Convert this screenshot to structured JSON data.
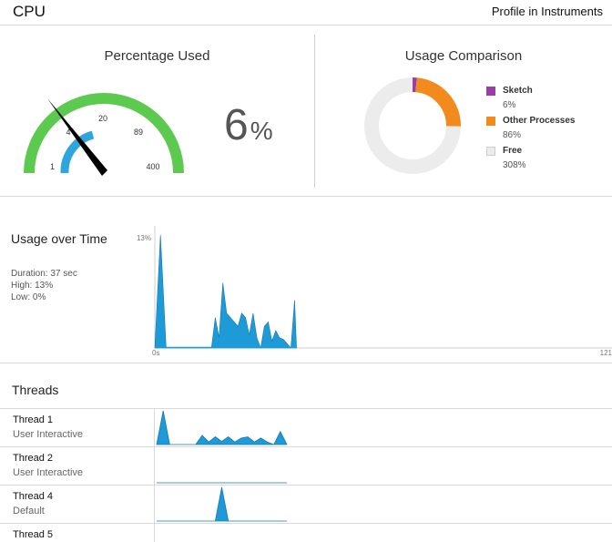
{
  "header": {
    "title": "CPU",
    "action_label": "Profile in Instruments"
  },
  "percentage_used": {
    "title": "Percentage Used",
    "value": "6",
    "unit": "%",
    "gauge": {
      "outer_ticks": [
        "1",
        "20",
        "89",
        "400"
      ],
      "inner_tick": "4",
      "outer_color": "#5cc94f",
      "inner_color": "#2ea6dd",
      "needle_color": "#000000",
      "needle_value_fraction": 0.06
    }
  },
  "usage_comparison": {
    "title": "Usage Comparison",
    "slices": [
      {
        "name": "Sketch",
        "value": "6%",
        "percent": 6,
        "color": "#9b3da5"
      },
      {
        "name": "Other Processes",
        "value": "86%",
        "percent": 86,
        "color": "#f28a1e"
      },
      {
        "name": "Free",
        "value": "308%",
        "percent": 308,
        "color": "#ececec"
      }
    ]
  },
  "usage_over_time": {
    "title": "Usage over Time",
    "duration": "Duration: 37 sec",
    "high": "High: 13%",
    "low": "Low: 0%",
    "y_max_label": "13%",
    "x_start_label": "0s",
    "x_end_label": "121",
    "fill_color": "#1e9bd7"
  },
  "chart_data": {
    "type": "area",
    "title": "",
    "xlabel": "",
    "ylabel": "",
    "y_unit": "%",
    "xlim": [
      0,
      121
    ],
    "ylim": [
      0,
      13
    ],
    "x": [
      0,
      1.5,
      3,
      4,
      6,
      13,
      15,
      16,
      17,
      18,
      19,
      20,
      21,
      22,
      23,
      24,
      25,
      26,
      27,
      28,
      29,
      30,
      31,
      32,
      33,
      34,
      35,
      36,
      37,
      37.5
    ],
    "values": [
      0,
      13,
      0,
      0,
      0,
      0,
      0,
      3.5,
      1.2,
      7.5,
      4,
      3.5,
      3,
      2.5,
      4,
      3.5,
      1.5,
      4,
      1.2,
      0,
      2.5,
      3,
      0.8,
      2,
      1.2,
      1,
      0.5,
      0,
      5.5,
      0
    ],
    "grid": false,
    "legend": "none"
  },
  "threads": {
    "title": "Threads",
    "items": [
      {
        "name": "Thread 1",
        "qos": "User Interactive",
        "activity": [
          0,
          13,
          0,
          0,
          0,
          0,
          0,
          3.5,
          1,
          3,
          1.2,
          3,
          1,
          2.5,
          3,
          1,
          2.5,
          1,
          0,
          5,
          0
        ]
      },
      {
        "name": "Thread 2",
        "qos": "User Interactive",
        "activity": [
          0,
          0,
          0,
          0,
          0,
          0,
          0,
          0,
          0,
          0,
          0,
          0,
          0,
          0,
          0,
          0,
          0,
          0,
          0,
          0,
          0
        ]
      },
      {
        "name": "Thread 4",
        "qos": "Default",
        "activity": [
          0,
          0,
          0,
          0,
          0,
          0,
          0,
          0,
          0,
          0,
          13,
          0,
          0,
          0,
          0,
          0,
          0,
          0,
          0,
          0,
          0
        ]
      },
      {
        "name": "Thread 5",
        "qos": "",
        "activity": []
      }
    ]
  }
}
